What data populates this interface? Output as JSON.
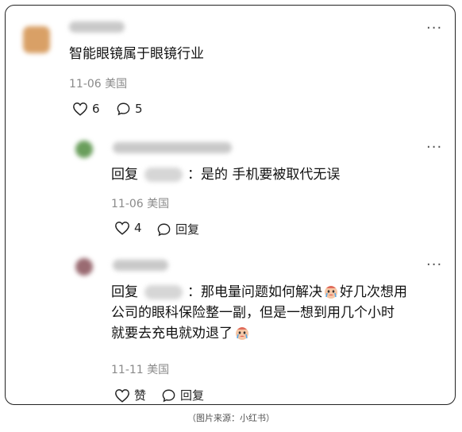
{
  "comments": [
    {
      "text": "智能眼镜属于眼镜行业",
      "date": "11-06",
      "location": "美国",
      "likes": "6",
      "replies": "5"
    }
  ],
  "replies": [
    {
      "prefix": "回复",
      "text": "：是的 手机要被取代无误",
      "date": "11-06",
      "location": "美国",
      "likes": "4",
      "reply_label": "回复"
    },
    {
      "prefix": "回复",
      "line1": "：那电量问题如何解决",
      "line1b": "好几次想用",
      "line2": "公司的眼科保险整一副，但是一想到用几个小时",
      "line3": "就要去充电就劝退了",
      "date": "11-11",
      "location": "美国",
      "like_label": "赞",
      "reply_label": "回复"
    }
  ],
  "more_label": "···",
  "caption": "（图片来源：小红书）",
  "colors": {
    "avatar1": "#d9a066",
    "avatar2": "#6a9e5c",
    "avatar3": "#9a6b72"
  }
}
